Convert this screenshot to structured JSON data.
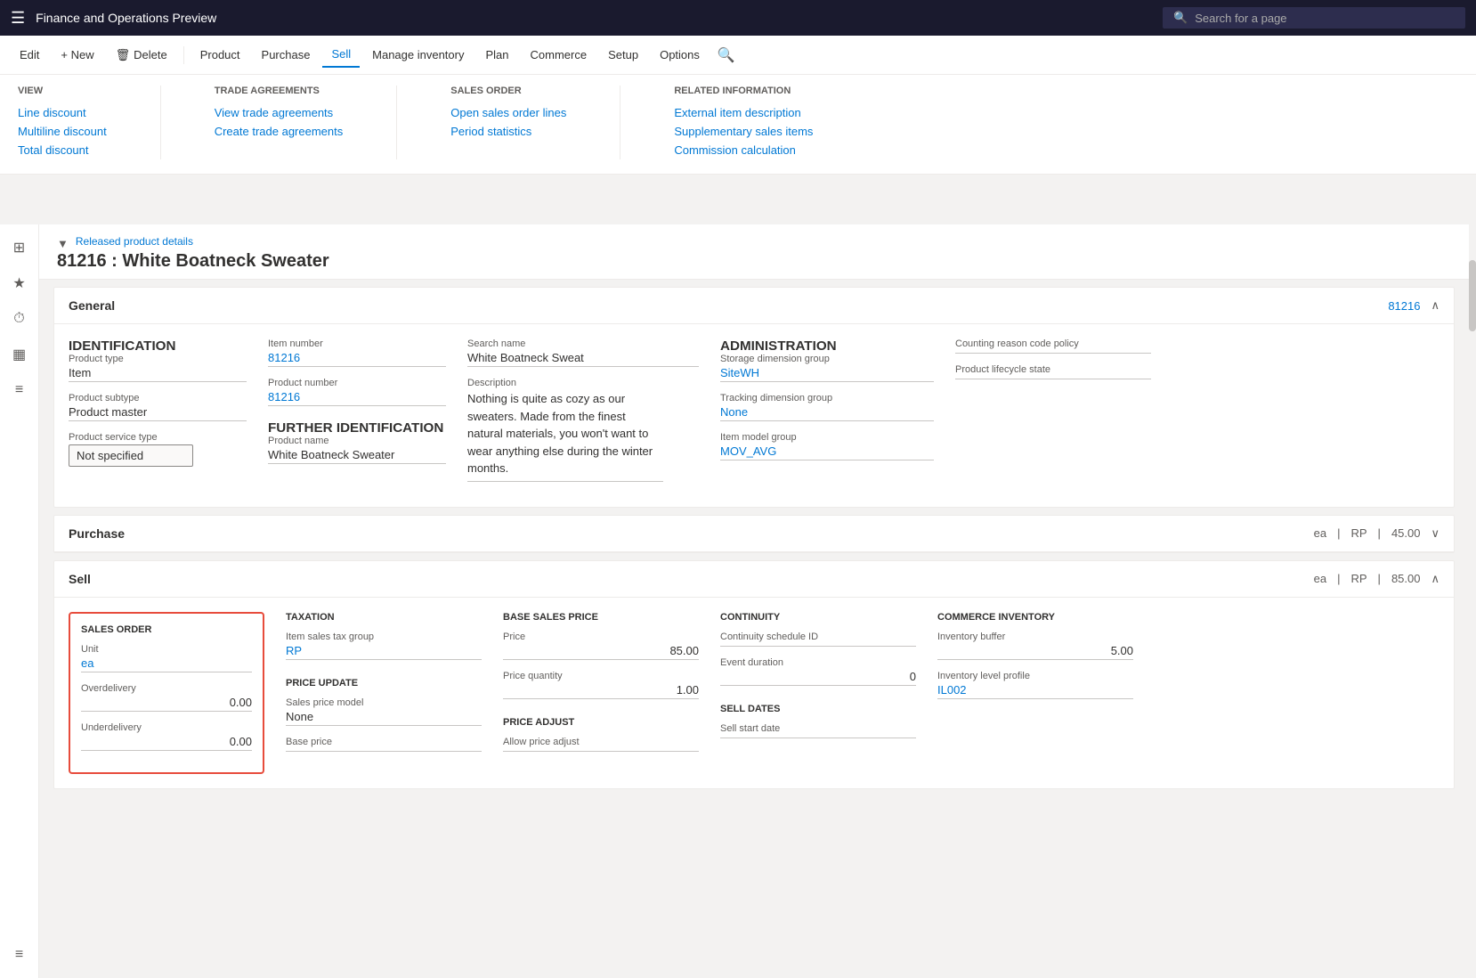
{
  "app": {
    "title": "Finance and Operations Preview",
    "search_placeholder": "Search for a page"
  },
  "command_bar": {
    "edit_label": "Edit",
    "new_label": "+ New",
    "delete_label": "Delete",
    "product_label": "Product",
    "purchase_label": "Purchase",
    "sell_label": "Sell",
    "manage_inventory_label": "Manage inventory",
    "plan_label": "Plan",
    "commerce_label": "Commerce",
    "setup_label": "Setup",
    "options_label": "Options"
  },
  "sell_menu": {
    "view": {
      "title": "View",
      "items": [
        "Line discount",
        "Multiline discount",
        "Total discount"
      ]
    },
    "trade_agreements": {
      "title": "Trade agreements",
      "items": [
        "View trade agreements",
        "Create trade agreements"
      ]
    },
    "sales_order": {
      "title": "Sales order",
      "items": [
        "Open sales order lines",
        "Period statistics"
      ]
    },
    "related_information": {
      "title": "Related information",
      "items": [
        "External item description",
        "Supplementary sales items",
        "Commission calculation"
      ]
    }
  },
  "page": {
    "breadcrumb": "Released product details",
    "title": "81216 : White Boatneck Sweater"
  },
  "general_section": {
    "label": "General",
    "id": "81216",
    "identification": {
      "title": "IDENTIFICATION",
      "product_type_label": "Product type",
      "product_type_value": "Item",
      "product_subtype_label": "Product subtype",
      "product_subtype_value": "Product master",
      "product_service_type_label": "Product service type",
      "product_service_type_value": "Not specified"
    },
    "item_number": {
      "label": "Item number",
      "value": "81216"
    },
    "product_number": {
      "label": "Product number",
      "value": "81216"
    },
    "further_identification": {
      "title": "FURTHER IDENTIFICATION",
      "product_name_label": "Product name",
      "product_name_value": "White Boatneck Sweater"
    },
    "search_name": {
      "label": "Search name",
      "value": "White Boatneck Sweat"
    },
    "description": {
      "label": "Description",
      "value": "Nothing is quite as cozy as our sweaters. Made from the finest natural materials, you won't want to wear anything else during the winter months."
    },
    "administration": {
      "title": "ADMINISTRATION",
      "storage_dimension_group_label": "Storage dimension group",
      "storage_dimension_group_value": "SiteWH",
      "tracking_dimension_group_label": "Tracking dimension group",
      "tracking_dimension_group_value": "None",
      "item_model_group_label": "Item model group",
      "item_model_group_value": "MOV_AVG"
    },
    "counting_reason_code_policy": {
      "label": "Counting reason code policy",
      "value": ""
    },
    "product_lifecycle_state": {
      "label": "Product lifecycle state",
      "value": ""
    }
  },
  "purchase_section": {
    "label": "Purchase",
    "unit": "ea",
    "rp": "RP",
    "price": "45.00"
  },
  "sell_section": {
    "label": "Sell",
    "unit": "ea",
    "rp": "RP",
    "price": "85.00",
    "sales_order": {
      "title": "SALES ORDER",
      "unit_label": "Unit",
      "unit_value": "ea",
      "overdelivery_label": "Overdelivery",
      "overdelivery_value": "0.00",
      "underdelivery_label": "Underdelivery",
      "underdelivery_value": "0.00"
    },
    "taxation": {
      "title": "TAXATION",
      "item_sales_tax_group_label": "Item sales tax group",
      "item_sales_tax_group_value": "RP"
    },
    "price_update": {
      "title": "PRICE UPDATE",
      "sales_price_model_label": "Sales price model",
      "sales_price_model_value": "None",
      "base_price_label": "Base price",
      "base_price_value": ""
    },
    "base_sales_price": {
      "title": "BASE SALES PRICE",
      "price_label": "Price",
      "price_value": "85.00",
      "price_quantity_label": "Price quantity",
      "price_quantity_value": "1.00"
    },
    "price_adjust": {
      "title": "PRICE ADJUST",
      "allow_price_adjust_label": "Allow price adjust",
      "allow_price_adjust_value": ""
    },
    "continuity": {
      "title": "CONTINUITY",
      "continuity_schedule_id_label": "Continuity schedule ID",
      "continuity_schedule_id_value": "",
      "event_duration_label": "Event duration",
      "event_duration_value": "0"
    },
    "sell_dates": {
      "title": "SELL DATES",
      "sell_start_date_label": "Sell start date",
      "sell_start_date_value": ""
    },
    "commerce_inventory": {
      "title": "COMMERCE INVENTORY",
      "inventory_buffer_label": "Inventory buffer",
      "inventory_buffer_value": "5.00",
      "inventory_level_profile_label": "Inventory level profile",
      "inventory_level_profile_value": "IL002"
    }
  },
  "sidebar_icons": [
    "⊞",
    "★",
    "⏱",
    "▦",
    "≡",
    "≡"
  ],
  "colors": {
    "blue": "#0078d4",
    "red_border": "#e74c3c",
    "active_tab": "#0078d4"
  }
}
